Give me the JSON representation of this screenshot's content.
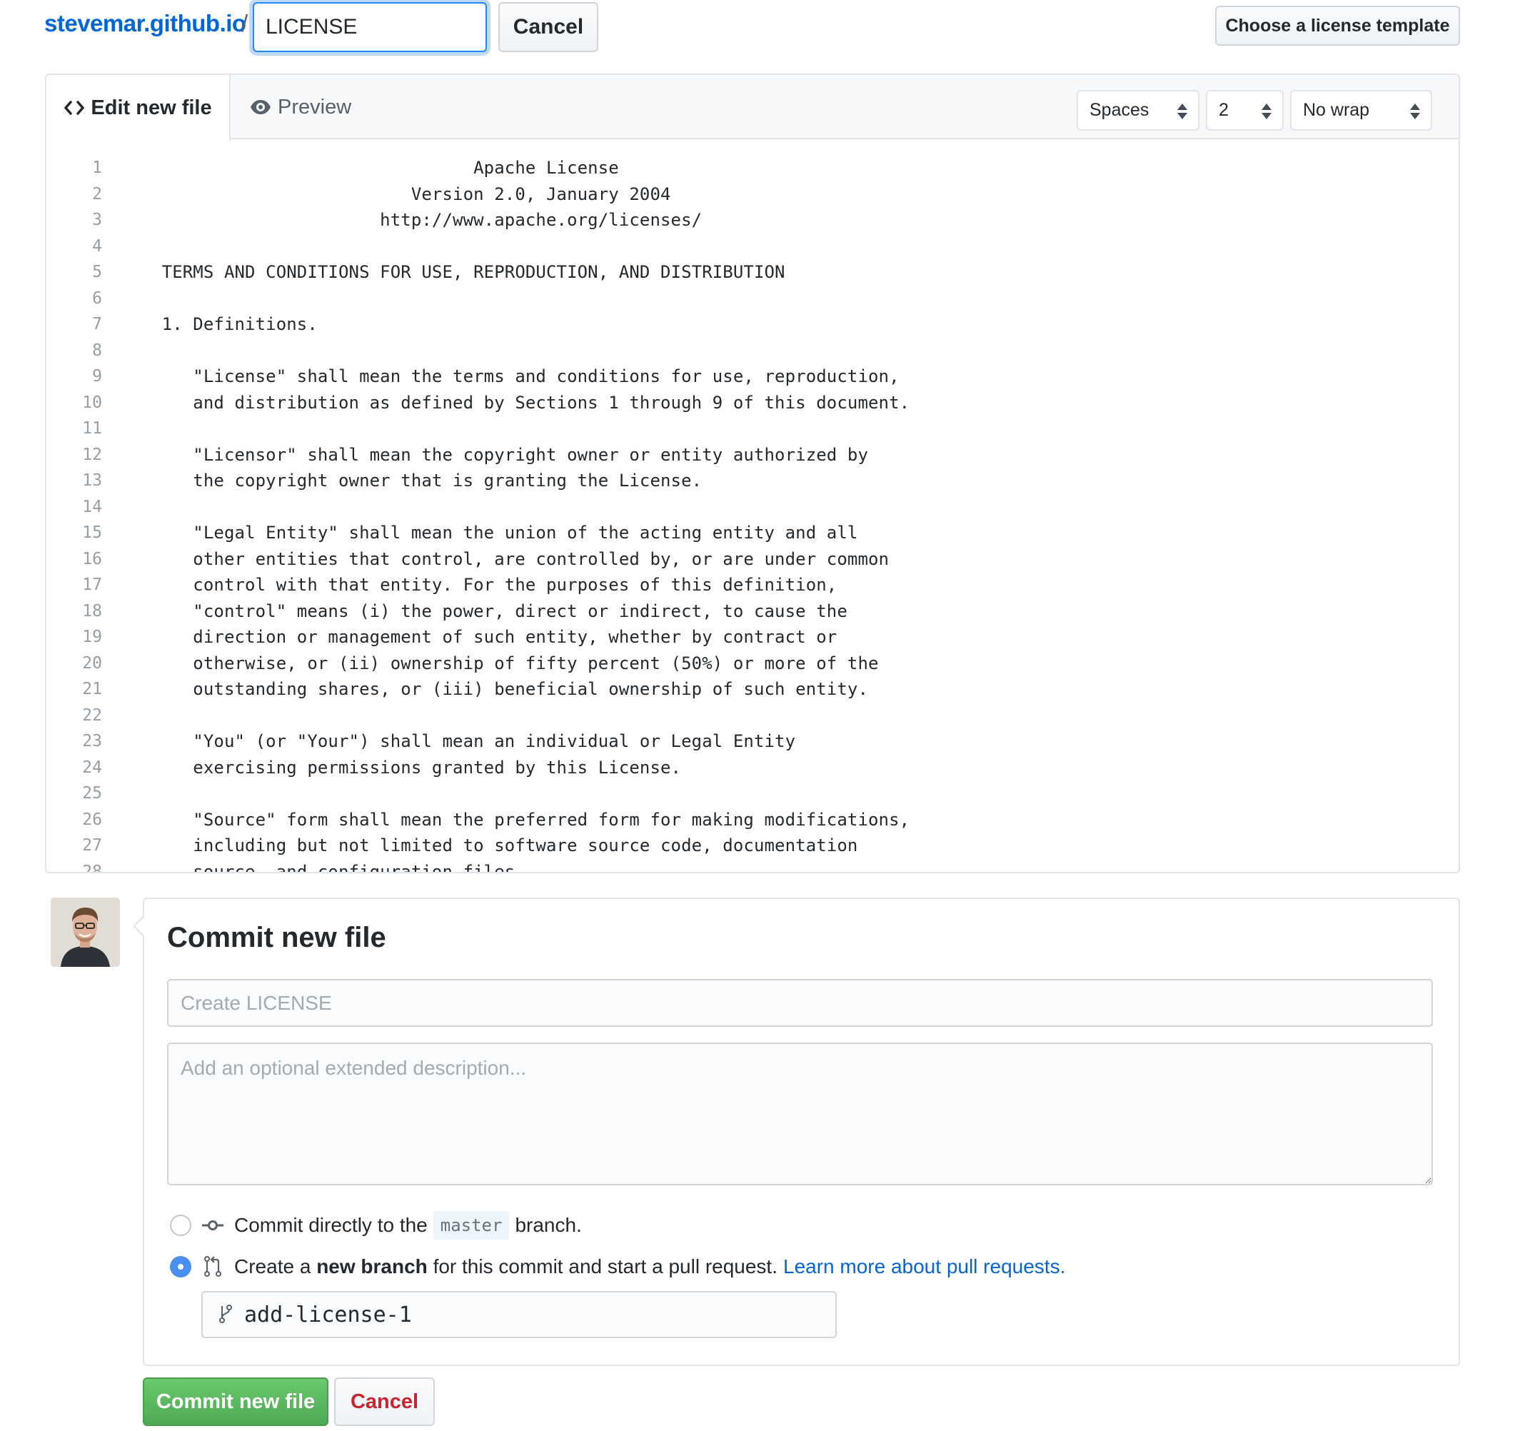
{
  "breadcrumb": {
    "repo": "stevemar.github.io",
    "separator": "/",
    "filename_value": "LICENSE",
    "cancel_label": "Cancel"
  },
  "license_template_button": "Choose a license template",
  "editor": {
    "tabs": [
      {
        "label": "Edit new file",
        "icon": "code-icon",
        "active": true
      },
      {
        "label": "Preview",
        "icon": "eye-icon",
        "active": false
      }
    ],
    "indent_mode": "Spaces",
    "indent_size": "2",
    "wrap_mode": "No wrap",
    "lines": [
      "                                 Apache License",
      "                           Version 2.0, January 2004",
      "                        http://www.apache.org/licenses/",
      "",
      "   TERMS AND CONDITIONS FOR USE, REPRODUCTION, AND DISTRIBUTION",
      "",
      "   1. Definitions.",
      "",
      "      \"License\" shall mean the terms and conditions for use, reproduction,",
      "      and distribution as defined by Sections 1 through 9 of this document.",
      "",
      "      \"Licensor\" shall mean the copyright owner or entity authorized by",
      "      the copyright owner that is granting the License.",
      "",
      "      \"Legal Entity\" shall mean the union of the acting entity and all",
      "      other entities that control, are controlled by, or are under common",
      "      control with that entity. For the purposes of this definition,",
      "      \"control\" means (i) the power, direct or indirect, to cause the",
      "      direction or management of such entity, whether by contract or",
      "      otherwise, or (ii) ownership of fifty percent (50%) or more of the",
      "      outstanding shares, or (iii) beneficial ownership of such entity.",
      "",
      "      \"You\" (or \"Your\") shall mean an individual or Legal Entity",
      "      exercising permissions granted by this License.",
      "",
      "      \"Source\" form shall mean the preferred form for making modifications,",
      "      including but not limited to software source code, documentation",
      "      source, and configuration files."
    ]
  },
  "commit": {
    "title": "Commit new file",
    "summary_placeholder": "Create LICENSE",
    "description_placeholder": "Add an optional extended description...",
    "option_direct": {
      "prefix": "Commit directly to the",
      "branch": "master",
      "suffix": "branch.",
      "selected": false
    },
    "option_new_branch": {
      "prefix": "Create a",
      "bold": "new branch",
      "suffix": "for this commit and start a pull request.",
      "link": "Learn more about pull requests.",
      "selected": true
    },
    "branch_name": "add-license-1",
    "commit_button": "Commit new file",
    "cancel_button": "Cancel"
  },
  "colors": {
    "link": "#0366d6",
    "commit_green": "#4ea955",
    "cancel_red": "#cb2431",
    "focus_blue": "#2188ff"
  }
}
